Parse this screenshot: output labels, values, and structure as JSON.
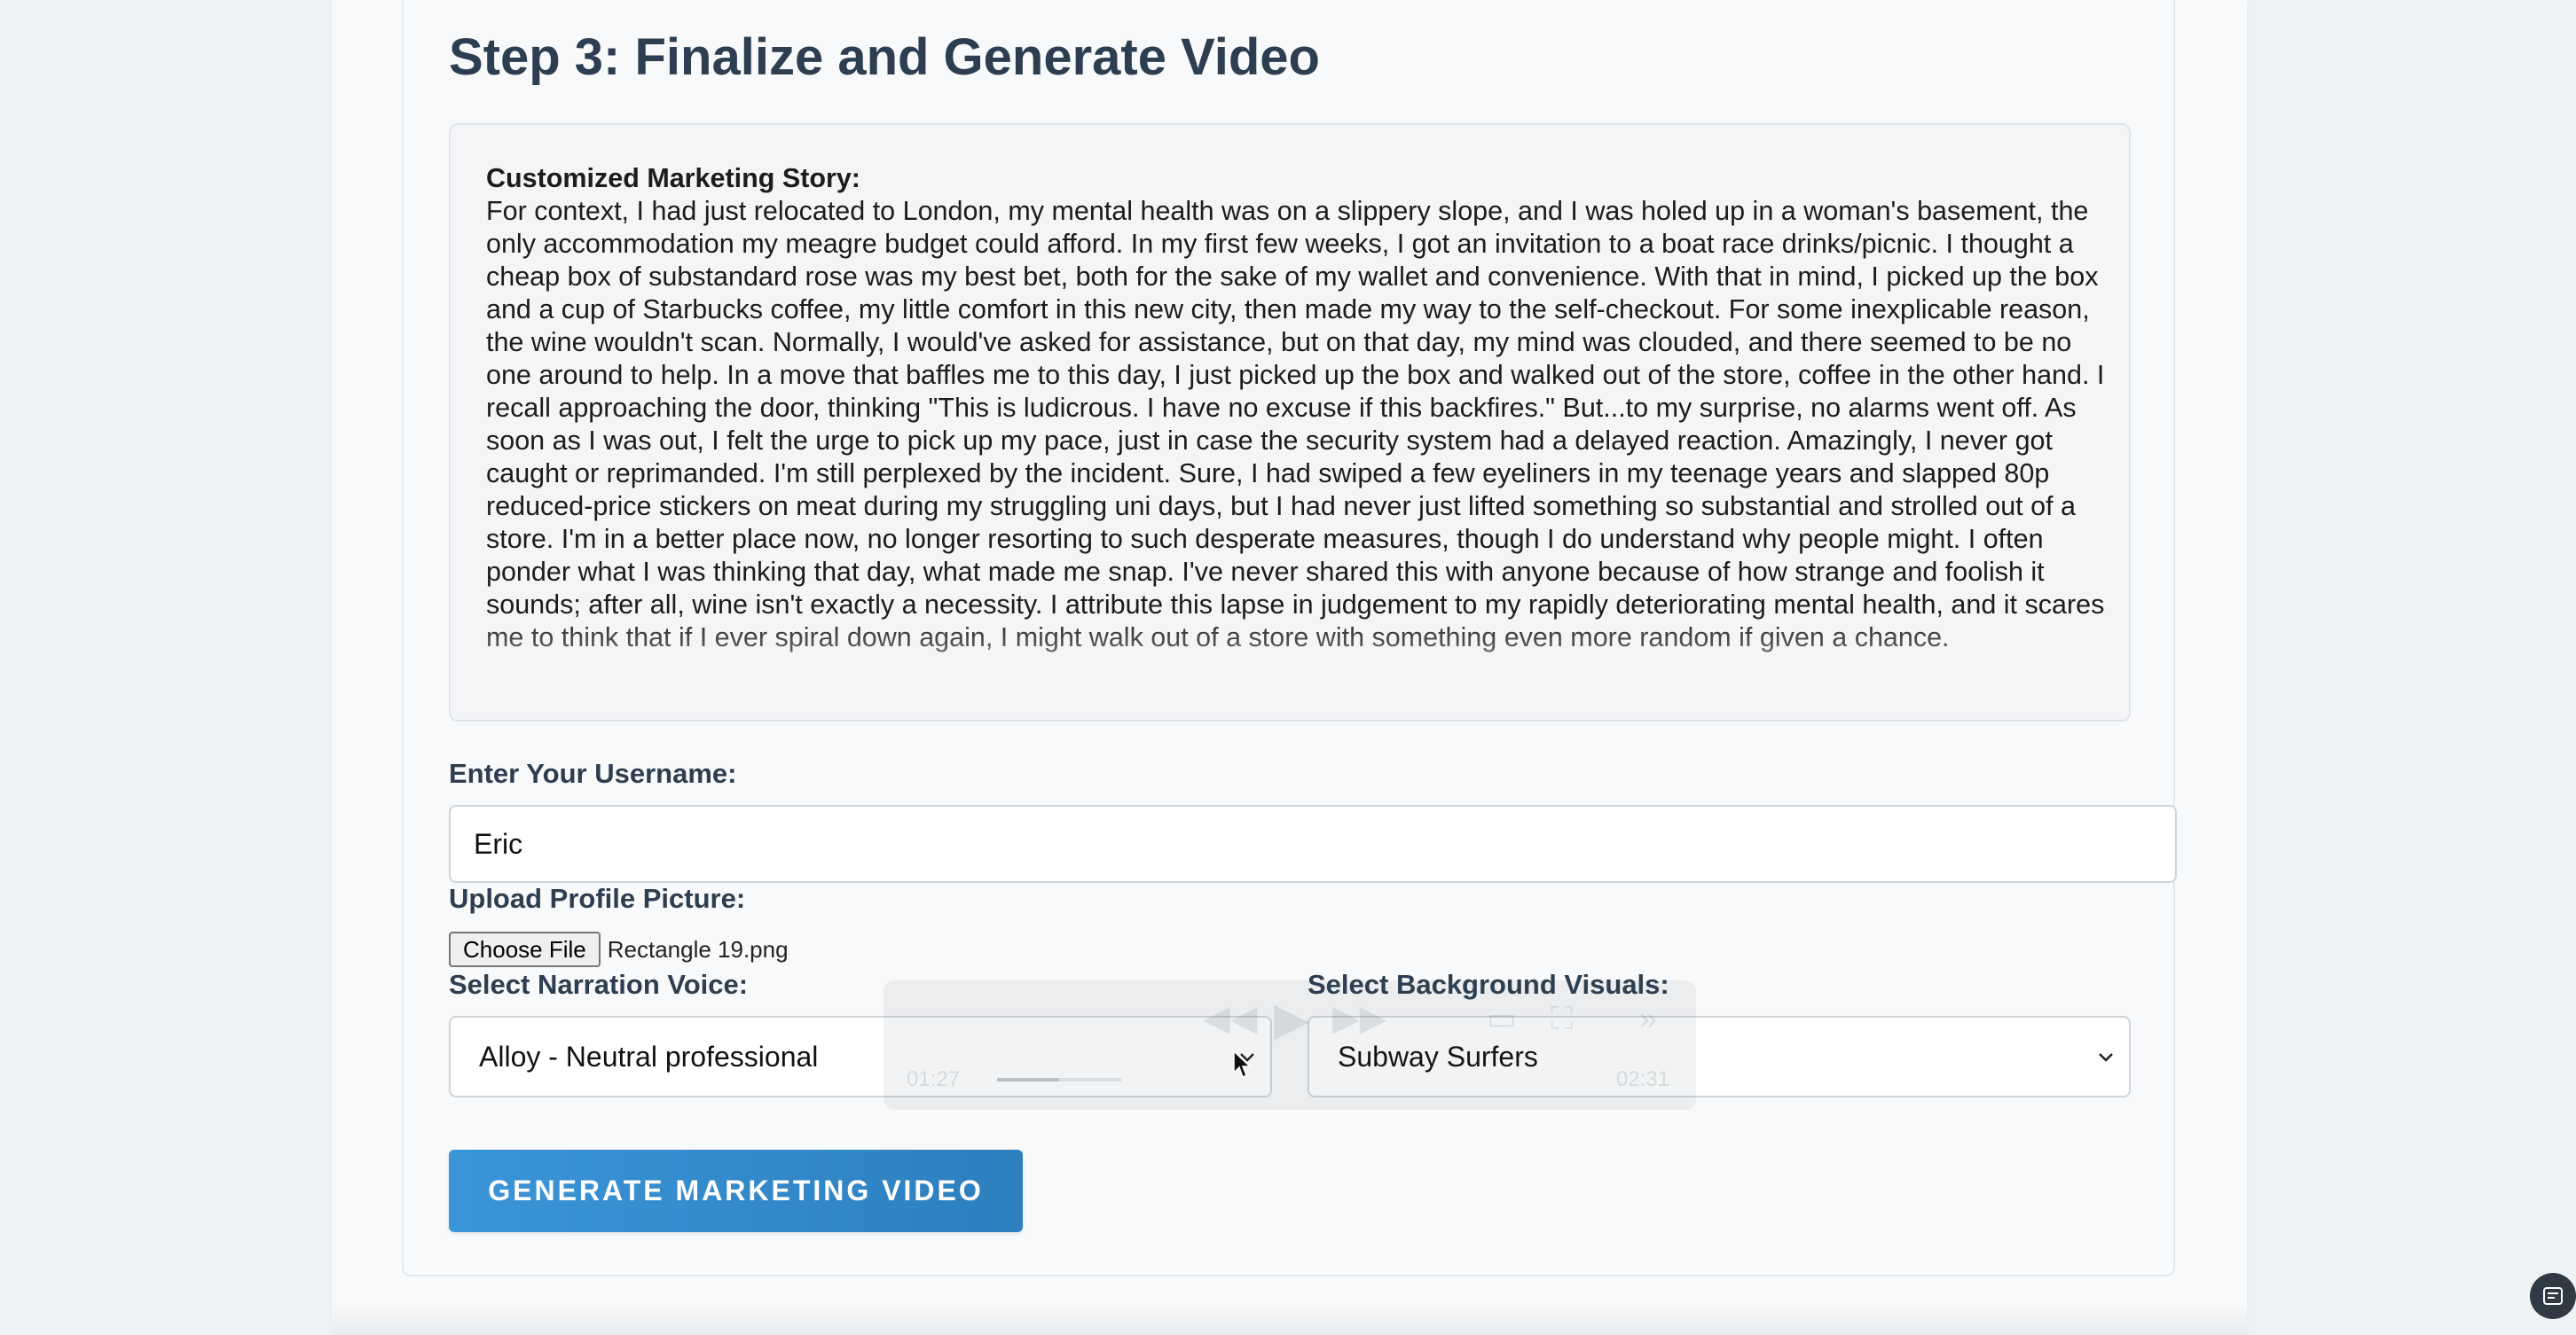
{
  "step": {
    "title": "Step 3: Finalize and Generate Video"
  },
  "story": {
    "label": "Customized Marketing Story:",
    "text": "For context, I had just relocated to London, my mental health was on a slippery slope, and I was holed up in a woman's basement, the only accommodation my meagre budget could afford. In my first few weeks, I got an invitation to a boat race drinks/picnic. I thought a cheap box of substandard rose was my best bet, both for the sake of my wallet and convenience. With that in mind, I picked up the box and a cup of Starbucks coffee, my little comfort in this new city, then made my way to the self-checkout. For some inexplicable reason, the wine wouldn't scan. Normally, I would've asked for assistance, but on that day, my mind was clouded, and there seemed to be no one around to help. In a move that baffles me to this day, I just picked up the box and walked out of the store, coffee in the other hand. I recall approaching the door, thinking \"This is ludicrous. I have no excuse if this backfires.\" But...to my surprise, no alarms went off. As soon as I was out, I felt the urge to pick up my pace, just in case the security system had a delayed reaction. Amazingly, I never got caught or reprimanded. I'm still perplexed by the incident. Sure, I had swiped a few eyeliners in my teenage years and slapped 80p reduced-price stickers on meat during my struggling uni days, but I had never just lifted something so substantial and strolled out of a store. I'm in a better place now, no longer resorting to such desperate measures, though I do understand why people might. I often ponder what I was thinking that day, what made me snap. I've never shared this with anyone because of how strange and foolish it sounds; after all, wine isn't exactly a necessity. I attribute this lapse in judgement to my rapidly deteriorating mental health, and it scares me to think that if I ever spiral down again, I might walk out of a store with something even more random if given a chance."
  },
  "username": {
    "label": "Enter Your Username:",
    "value": "Eric"
  },
  "profile_picture": {
    "label": "Upload Profile Picture:",
    "button_label": "Choose File",
    "file_name": "Rectangle 19.png"
  },
  "narration_voice": {
    "label": "Select Narration Voice:",
    "selected": "Alloy - Neutral professional"
  },
  "background_visuals": {
    "label": "Select Background Visuals:",
    "selected": "Subway Surfers"
  },
  "generate_button": {
    "label": "GENERATE MARKETING VIDEO"
  },
  "video_overlay": {
    "current_time": "01:27",
    "total_time": "02:31",
    "progress": 0.5
  },
  "icons": {
    "chevron": "chevron-down-icon",
    "cursor": "mouse-pointer-icon",
    "corner": "screen-capture-icon"
  },
  "colors": {
    "heading": "#2c3e50",
    "button_start": "#3a95d8",
    "button_end": "#2d7fbe",
    "page_bg": "#eef2f5",
    "panel_bg": "#f8f9fa"
  }
}
